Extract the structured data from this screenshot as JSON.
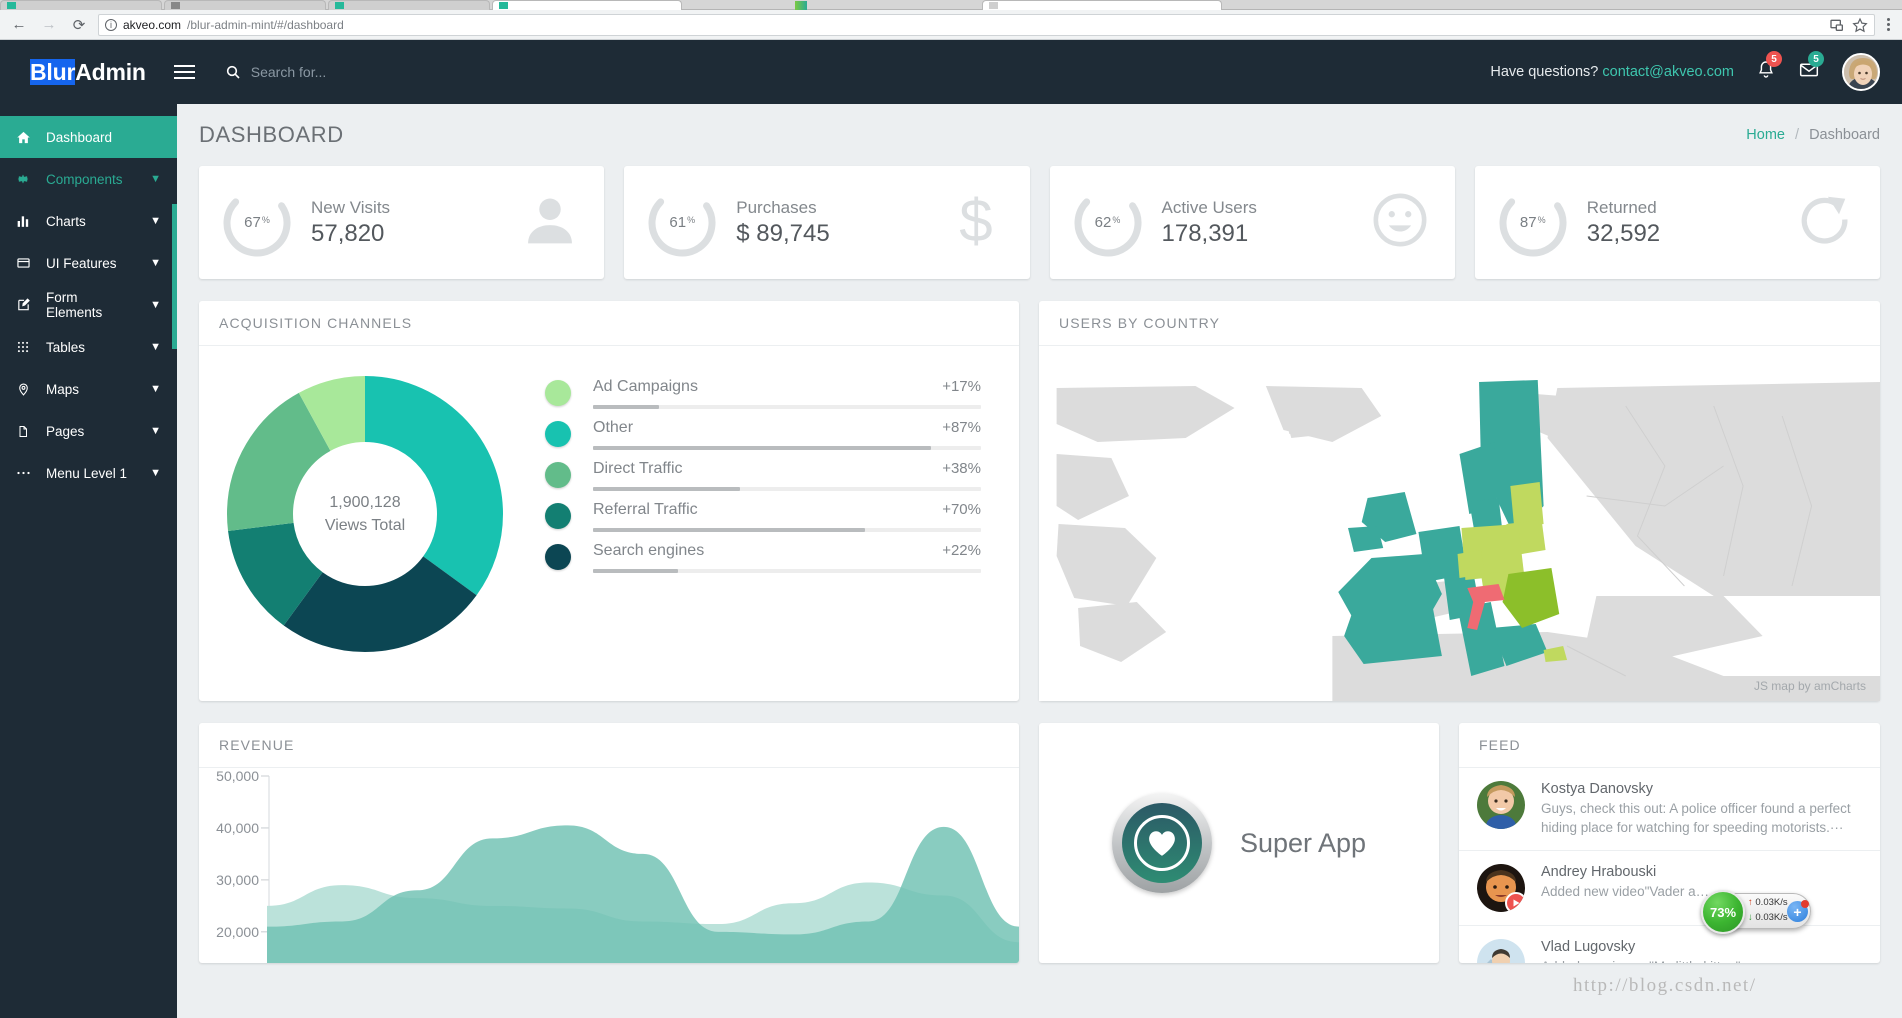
{
  "browser": {
    "url_host": "akveo.com",
    "url_path": "/blur-admin-mint/#/dashboard",
    "back_icon": "back-arrow-icon",
    "forward_icon": "forward-arrow-icon",
    "reload_icon": "reload-icon",
    "info_glyph": "i",
    "cast_icon": "cast-icon",
    "bookmark_icon": "star-icon",
    "menu_icon": "kebab-menu-icon"
  },
  "topbar": {
    "brand_prefix": "Blur",
    "brand_suffix": "Admin",
    "search_placeholder": "Search for...",
    "search_value": "",
    "have_questions": "Have questions?",
    "contact_email": "contact@akveo.com",
    "notifications_count": "5",
    "messages_count": "5",
    "accent": "#2aab93"
  },
  "sidebar": {
    "items": [
      {
        "label": "Dashboard",
        "icon": "home-icon",
        "state": "active",
        "expandable": false
      },
      {
        "label": "Components",
        "icon": "gear-icon",
        "state": "hover",
        "expandable": true
      },
      {
        "label": "Charts",
        "icon": "bar-chart-icon",
        "state": "normal",
        "expandable": true
      },
      {
        "label": "UI Features",
        "icon": "window-icon",
        "state": "normal",
        "expandable": true
      },
      {
        "label": "Form Elements",
        "icon": "edit-icon",
        "state": "normal",
        "expandable": true
      },
      {
        "label": "Tables",
        "icon": "grid-icon",
        "state": "normal",
        "expandable": true
      },
      {
        "label": "Maps",
        "icon": "map-pin-icon",
        "state": "normal",
        "expandable": true
      },
      {
        "label": "Pages",
        "icon": "page-icon",
        "state": "normal",
        "expandable": true
      },
      {
        "label": "Menu Level 1",
        "icon": "ellipsis-icon",
        "state": "normal",
        "expandable": true
      }
    ]
  },
  "page": {
    "title": "DASHBOARD",
    "breadcrumb_home": "Home",
    "breadcrumb_sep": "/",
    "breadcrumb_current": "Dashboard"
  },
  "stats": [
    {
      "percent": "67",
      "pct_sym": "%",
      "label": "New Visits",
      "value": "57,820",
      "icon": "person-icon"
    },
    {
      "percent": "61",
      "pct_sym": "%",
      "label": "Purchases",
      "value": "$ 89,745",
      "icon": "dollar-icon"
    },
    {
      "percent": "62",
      "pct_sym": "%",
      "label": "Active Users",
      "value": "178,391",
      "icon": "smiley-icon"
    },
    {
      "percent": "87",
      "pct_sym": "%",
      "label": "Returned",
      "value": "32,592",
      "icon": "refresh-icon"
    }
  ],
  "acquisition": {
    "title": "ACQUISITION CHANNELS",
    "center_value": "1,900,128",
    "center_label": "Views Total"
  },
  "map": {
    "title": "USERS BY COUNTRY",
    "credit": "JS map by amCharts"
  },
  "revenue": {
    "title": "REVENUE"
  },
  "superapp": {
    "title": "Super App",
    "icon": "heart-icon"
  },
  "feed": {
    "title": "FEED",
    "items": [
      {
        "name": "Kostya Danovsky",
        "text": "Guys, check this out: A police officer found a perfect hiding place for watching for speeding motorists.···",
        "badge": "none"
      },
      {
        "name": "Andrey Hrabouski",
        "text": "Added new video\"Vader a…",
        "badge": "play-icon"
      },
      {
        "name": "Vlad Lugovsky",
        "text": "Added new image\"My little kitten\"",
        "badge": "image-icon"
      }
    ]
  },
  "overlay": {
    "cpu_percent": "73%",
    "upload_rate": "0.03K/s",
    "download_rate": "0.03K/s",
    "add_label": "+",
    "watermark": "http://blog.csdn.net/"
  },
  "chart_data": [
    {
      "type": "pie",
      "title": "ACQUISITION CHANNELS",
      "subtitle": "1,900,128 Views Total",
      "legend_position": "right",
      "labels": [
        "Ad Campaigns",
        "Other",
        "Direct Traffic",
        "Referral Traffic",
        "Search engines"
      ],
      "delta_labels": [
        "+17%",
        "+87%",
        "+38%",
        "+70%",
        "+22%"
      ],
      "bar_values": [
        17,
        87,
        38,
        70,
        22
      ],
      "slice_shares": [
        8,
        35,
        19,
        13,
        25
      ],
      "slice_order": [
        "Other",
        "Search engines",
        "Referral Traffic",
        "Direct Traffic",
        "Ad Campaigns"
      ],
      "slice_order_shares": [
        35,
        25,
        13,
        19,
        8
      ],
      "colors": [
        "#a8e89a",
        "#18c2b0",
        "#62bc8a",
        "#137f72",
        "#0c4653"
      ],
      "slice_order_colors": [
        "#18c2b0",
        "#0c4653",
        "#137f72",
        "#62bc8a",
        "#a8e89a"
      ]
    },
    {
      "type": "area",
      "title": "REVENUE",
      "ylabel": "",
      "xlabel": "",
      "ylim": [
        0,
        50000
      ],
      "yticks": [
        "20,000",
        "30,000",
        "40,000",
        "50,000"
      ],
      "ytick_values": [
        20000,
        30000,
        40000,
        50000
      ],
      "grid": false,
      "x": [
        0,
        1,
        2,
        3,
        4,
        5,
        6,
        7,
        8,
        9,
        10
      ],
      "series": [
        {
          "name": "series-light",
          "color": "#b7e0d8",
          "values": [
            25000,
            29000,
            26500,
            25000,
            24500,
            22000,
            21500,
            25500,
            29500,
            27000,
            18000
          ]
        },
        {
          "name": "series-dark",
          "color": "#6fc1b2",
          "values": [
            21000,
            22000,
            28000,
            38000,
            40500,
            35000,
            20000,
            19500,
            22000,
            40200,
            21000
          ]
        }
      ]
    },
    {
      "type": "heatmap",
      "title": "USERS BY COUNTRY",
      "note": "Choropleth map of Europe",
      "color_scale": [
        "#3aa99c",
        "#c0d95f",
        "#8cbf2a",
        "#ef6b73",
        "#dcdcdc"
      ]
    }
  ],
  "gauges": {
    "track_color": "#dcdfe1"
  }
}
